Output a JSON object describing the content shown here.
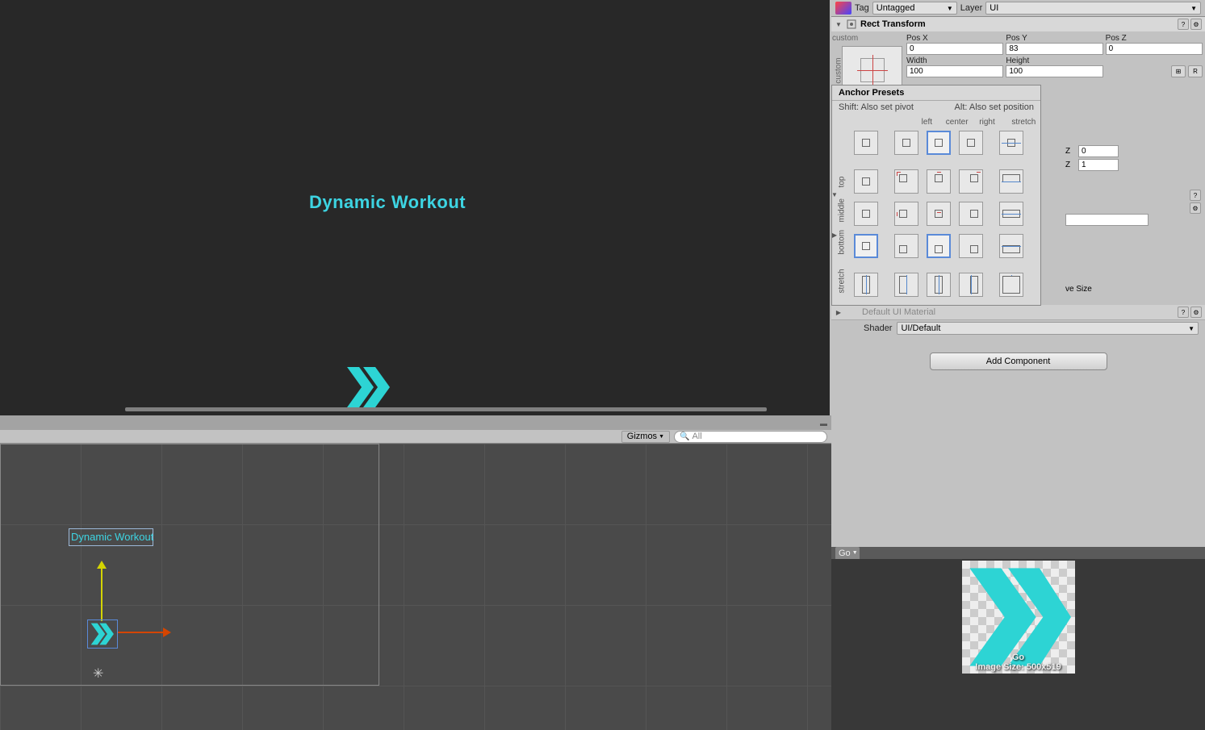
{
  "game": {
    "title_text": "Dynamic Workout"
  },
  "scene": {
    "title_text": "Dynamic Workout",
    "gizmos_label": "Gizmos",
    "search_placeholder": "All"
  },
  "inspector": {
    "tag_label": "Tag",
    "tag_value": "Untagged",
    "layer_label": "Layer",
    "layer_value": "UI",
    "rect_transform": {
      "title": "Rect Transform",
      "custom": "custom",
      "pos_x_label": "Pos X",
      "pos_y_label": "Pos Y",
      "pos_z_label": "Pos Z",
      "pos_x": "0",
      "pos_y": "83",
      "pos_z": "0",
      "width_label": "Width",
      "height_label": "Height",
      "width": "100",
      "height": "100",
      "r_btn": "R"
    },
    "anchor_presets": {
      "title": "Anchor Presets",
      "shift_hint": "Shift: Also set pivot",
      "alt_hint": "Alt: Also set position",
      "cols": {
        "left": "left",
        "center": "center",
        "right": "right",
        "stretch": "stretch"
      },
      "rows": {
        "top": "top",
        "middle": "middle",
        "bottom": "bottom",
        "stretch": "stretch"
      }
    },
    "z_fields": {
      "z0_label": "Z",
      "z0_value": "0",
      "z1_label": "Z",
      "z1_value": "1"
    },
    "native_size": "ve Size",
    "material_label": "Default UI Material",
    "shader_label": "Shader",
    "shader_value": "UI/Default",
    "add_component": "Add Component"
  },
  "asset": {
    "tab": "Go",
    "name": "Go",
    "size": "Image Size: 500x519"
  }
}
